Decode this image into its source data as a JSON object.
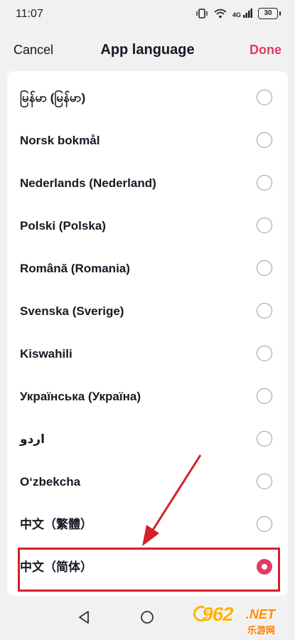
{
  "status_bar": {
    "time": "11:07",
    "battery": "30",
    "network": "4G"
  },
  "header": {
    "cancel_label": "Cancel",
    "title": "App language",
    "done_label": "Done"
  },
  "colors": {
    "accent": "#e03b63",
    "annotation": "#d4202a",
    "background": "#f1f1f2"
  },
  "languages": [
    {
      "label": "မြန်မာ (မြန်မာ)",
      "selected": false
    },
    {
      "label": "Norsk bokmål",
      "selected": false
    },
    {
      "label": "Nederlands (Nederland)",
      "selected": false
    },
    {
      "label": "Polski (Polska)",
      "selected": false
    },
    {
      "label": "Română (Romania)",
      "selected": false
    },
    {
      "label": "Svenska (Sverige)",
      "selected": false
    },
    {
      "label": "Kiswahili",
      "selected": false
    },
    {
      "label": "Українська (Україна)",
      "selected": false
    },
    {
      "label": "اردو",
      "selected": false
    },
    {
      "label": "O‘zbekcha",
      "selected": false
    },
    {
      "label": "中文（繁體）",
      "selected": false
    },
    {
      "label": "中文（简体）",
      "selected": true
    }
  ],
  "nav_bar": {
    "icons": [
      "back-icon",
      "home-icon"
    ]
  },
  "watermark": {
    "number": "962",
    "suffix": ".NET",
    "subtitle": "乐游网"
  }
}
